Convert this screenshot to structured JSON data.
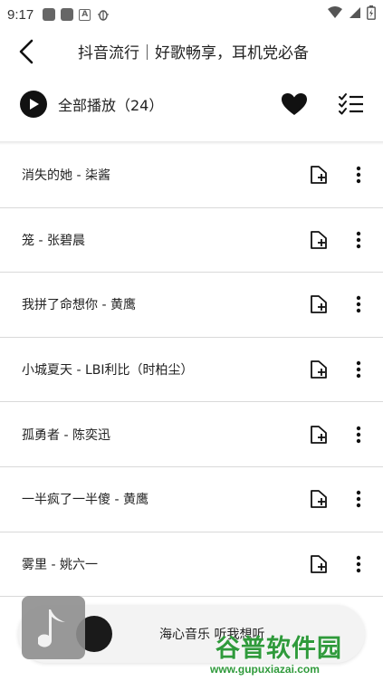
{
  "status_bar": {
    "time": "9:17",
    "left_icons": [
      "square-app-icon",
      "square-app-icon",
      "a-notification-icon",
      "bug-notification-icon"
    ],
    "right_icons": [
      "wifi-icon",
      "signal-icon",
      "battery-icon"
    ]
  },
  "header": {
    "title": "抖音流行｜好歌畅享，耳机党必备",
    "back_icon": "chevron-left-icon"
  },
  "play_bar": {
    "label": "全部播放（24）",
    "play_icon": "play-circle-icon",
    "favorite_icon": "heart-icon",
    "manage_icon": "checklist-icon"
  },
  "songs": [
    {
      "title": "消失的她 - 柒酱"
    },
    {
      "title": "笼 - 张碧晨"
    },
    {
      "title": "我拼了命想你 - 黄鹰"
    },
    {
      "title": "小城夏天 - LBI利比（时柏尘）"
    },
    {
      "title": "孤勇者 - 陈奕迅"
    },
    {
      "title": "一半疯了一半傻 - 黄鹰"
    },
    {
      "title": "雾里 - 姚六一"
    }
  ],
  "row_icons": {
    "add": "add-to-playlist-icon",
    "more": "more-vertical-icon"
  },
  "player": {
    "text": "海心音乐 听我想听",
    "note_icon": "music-note-icon"
  },
  "watermark": {
    "main": "谷普软件园",
    "url": "www.gupuxiazai.com"
  },
  "colors": {
    "accent": "#111111",
    "divider": "#d9d9d9",
    "watermark": "#2f9a3b",
    "player_bg": "#f3f3f3"
  }
}
